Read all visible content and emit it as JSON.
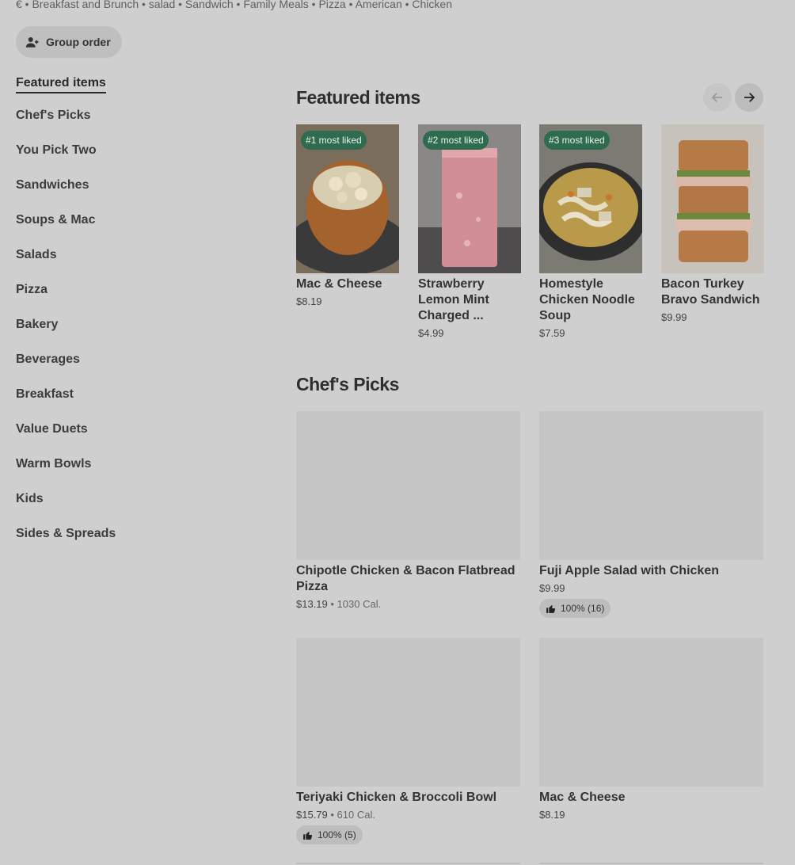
{
  "header": {
    "tags_line": "€ • Breakfast and Brunch • salad • Sandwich • Family Meals • Pizza • American • Chicken",
    "group_order_label": "Group order"
  },
  "sidebar": {
    "items": [
      {
        "label": "Featured items",
        "active": true
      },
      {
        "label": "Chef's Picks"
      },
      {
        "label": "You Pick Two"
      },
      {
        "label": "Sandwiches"
      },
      {
        "label": "Soups & Mac"
      },
      {
        "label": "Salads"
      },
      {
        "label": "Pizza"
      },
      {
        "label": "Bakery"
      },
      {
        "label": "Beverages"
      },
      {
        "label": "Breakfast"
      },
      {
        "label": "Value Duets"
      },
      {
        "label": "Warm Bowls"
      },
      {
        "label": "Kids"
      },
      {
        "label": "Sides & Spreads"
      }
    ]
  },
  "featured": {
    "title": "Featured items",
    "prev_icon": "arrow-left-icon",
    "next_icon": "arrow-right-icon",
    "items": [
      {
        "badge": "#1 most liked",
        "name": "Mac & Cheese",
        "price": "$8.19",
        "image": "mac-and-cheese-bread-bowl"
      },
      {
        "badge": "#2 most liked",
        "name": "Strawberry Lemon Mint Charged ...",
        "price": "$4.99",
        "image": "pink-lemonade-glass"
      },
      {
        "badge": "#3 most liked",
        "name": "Homestyle Chicken Noodle Soup",
        "price": "$7.59",
        "image": "chicken-noodle-soup-bowl"
      },
      {
        "badge": "",
        "name": "Bacon Turkey Bravo Sandwich",
        "price": "$9.99",
        "image": "turkey-sandwich-stack"
      }
    ]
  },
  "chefs_picks": {
    "title": "Chef's Picks",
    "items": [
      {
        "name": "Chipotle Chicken & Bacon Flatbread Pizza",
        "price": "$13.19",
        "separator": " • ",
        "calories": "1030 Cal.",
        "rating": ""
      },
      {
        "name": "Fuji Apple Salad with Chicken",
        "price": "$9.99",
        "separator": "",
        "calories": "",
        "rating": "100% (16)"
      },
      {
        "name": "Teriyaki Chicken & Broccoli Bowl",
        "price": "$15.79",
        "separator": " • ",
        "calories": "610 Cal.",
        "rating": "100% (5)"
      },
      {
        "name": "Mac & Cheese",
        "price": "$8.19",
        "separator": "",
        "calories": "",
        "rating": ""
      }
    ]
  },
  "colors": {
    "background": "#cfcfcf",
    "badge_green": "#2f6b4f",
    "placeholder": "#c5c5c5"
  }
}
